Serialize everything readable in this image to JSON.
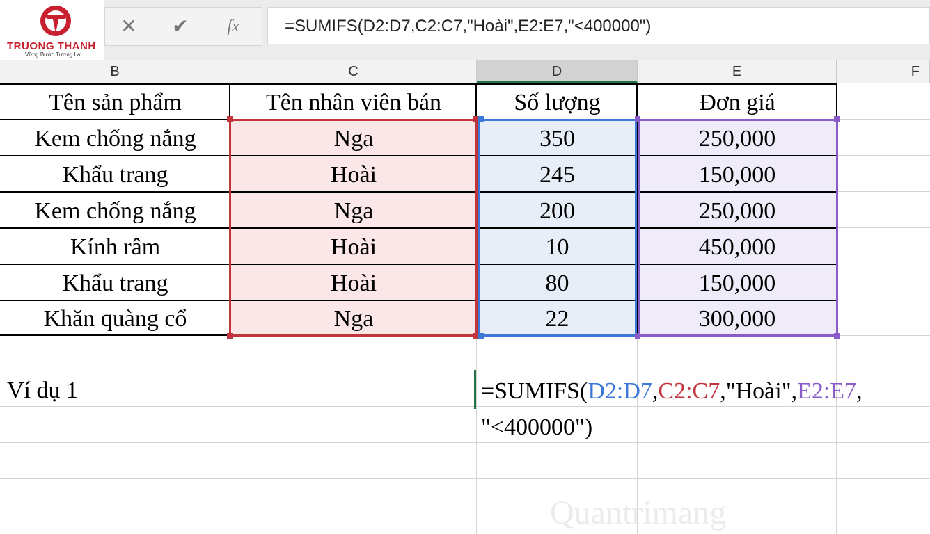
{
  "logo": {
    "brand": "TRUONG THANH",
    "slogan": "Vững Bước Tương Lai"
  },
  "formula_bar": {
    "cancel_icon": "✕",
    "confirm_icon": "✔",
    "function_icon": "fx",
    "formula": "=SUMIFS(D2:D7,C2:C7,\"Hoài\",E2:E7,\"<400000\")"
  },
  "columns": [
    "B",
    "C",
    "D",
    "E",
    "F"
  ],
  "table": {
    "headers": [
      "Tên sản phẩm",
      "Tên nhân viên bán",
      "Số lượng",
      "Đơn giá"
    ],
    "rows": [
      [
        "Kem chống nắng",
        "Nga",
        "350",
        "250,000"
      ],
      [
        "Khẩu trang",
        "Hoài",
        "245",
        "150,000"
      ],
      [
        "Kem chống nắng",
        "Nga",
        "200",
        "250,000"
      ],
      [
        "Kính râm",
        "Hoài",
        "10",
        "450,000"
      ],
      [
        "Khẩu trang",
        "Hoài",
        "80",
        "150,000"
      ],
      [
        "Khăn quàng cổ",
        "Nga",
        "22",
        "300,000"
      ]
    ]
  },
  "example": {
    "label": "Ví dụ 1",
    "f1": "=SUMIFS(",
    "f2": "D2:D7",
    "f3": ",",
    "f4": "C2:C7",
    "f5": ",\"Hoài\",",
    "f6": "E2:E7",
    "f7": ",",
    "f8": "\"<400000\")"
  },
  "watermark": "Quantrimang",
  "colors": {
    "red_range": "#c0343b",
    "blue_range": "#3b78d8",
    "purple_range": "#8a5cc8",
    "excel_green": "#217346"
  }
}
